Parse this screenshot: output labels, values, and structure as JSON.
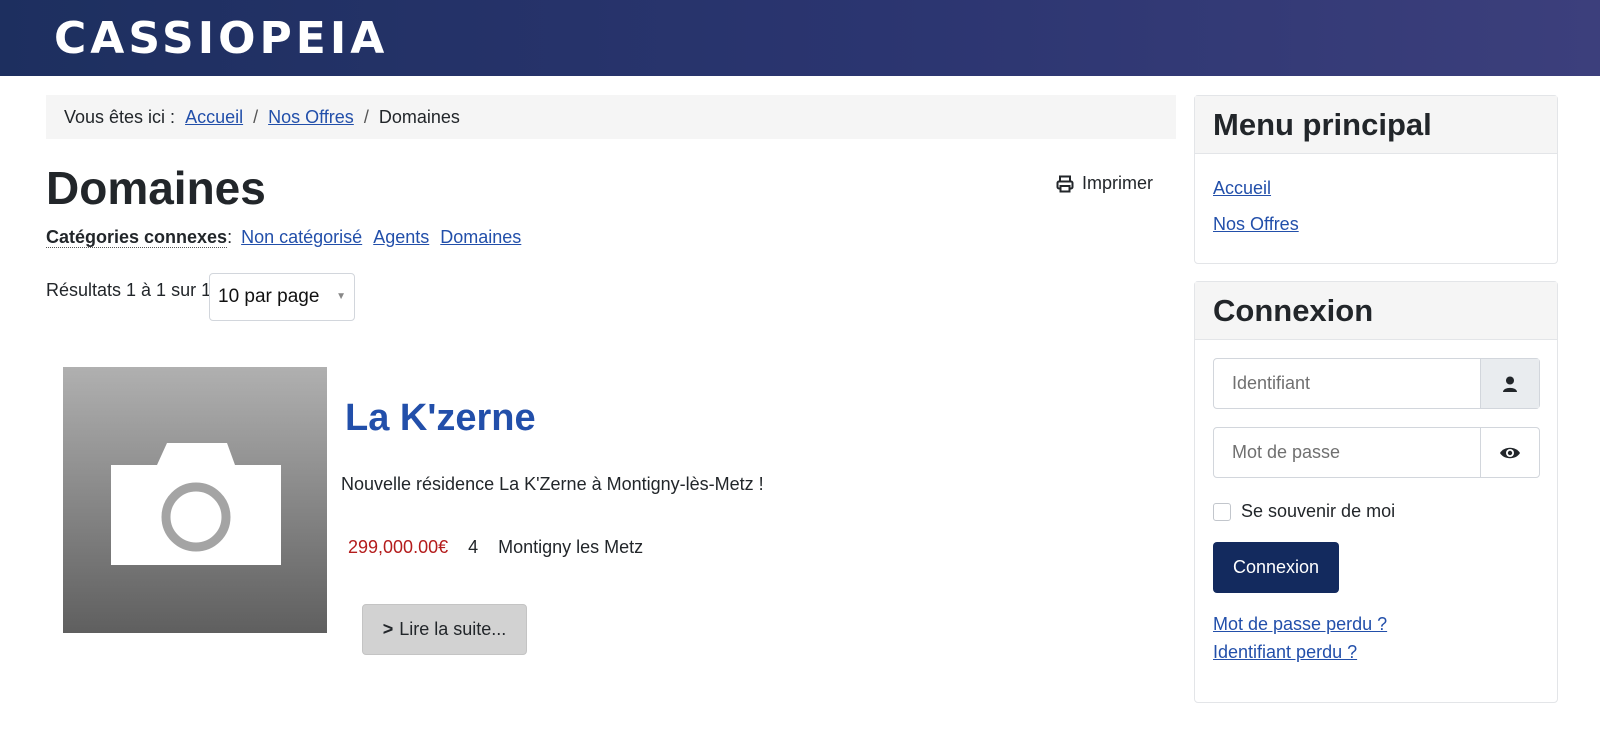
{
  "site": {
    "brand": "CASSIOPEIA"
  },
  "breadcrumb": {
    "lead": "Vous êtes ici :",
    "items": [
      "Accueil",
      "Nos Offres",
      "Domaines"
    ],
    "separator": "/"
  },
  "page": {
    "title": "Domaines",
    "print_label": "Imprimer",
    "related_label": "Catégories connexes",
    "related_colon": ":",
    "related": [
      "Non catégorisé",
      "Agents",
      "Domaines"
    ],
    "results_text": "Résultats 1 à 1 sur 1",
    "per_page": "10 par page"
  },
  "item": {
    "title": "La K'zerne",
    "description": "Nouvelle résidence La K'Zerne à Montigny-lès-Metz !",
    "price": "299,000.00€",
    "rooms": "4",
    "city": "Montigny les Metz",
    "read_more": "Lire la suite...",
    "image_icon": "camera-icon"
  },
  "menu": {
    "title": "Menu principal",
    "items": [
      "Accueil",
      "Nos Offres"
    ]
  },
  "login": {
    "title": "Connexion",
    "username_placeholder": "Identifiant",
    "password_placeholder": "Mot de passe",
    "remember_label": "Se souvenir de moi",
    "submit_label": "Connexion",
    "lost_password": "Mot de passe perdu ?",
    "lost_username": "Identifiant perdu ?"
  },
  "colors": {
    "header_start": "#1d2f5f",
    "header_end": "#3c3f7c",
    "link": "#224faa",
    "price": "#b41c1c",
    "button_primary": "#132a5e"
  }
}
